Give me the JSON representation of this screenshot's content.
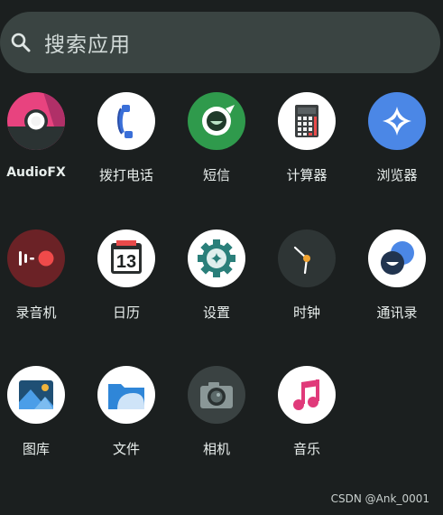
{
  "search": {
    "placeholder": "搜索应用"
  },
  "apps": [
    {
      "label": "AudioFX",
      "icon": "audiofx-icon"
    },
    {
      "label": "拨打电话",
      "icon": "phone-icon"
    },
    {
      "label": "短信",
      "icon": "messaging-icon"
    },
    {
      "label": "计算器",
      "icon": "calculator-icon"
    },
    {
      "label": "浏览器",
      "icon": "browser-icon"
    },
    {
      "label": "录音机",
      "icon": "recorder-icon"
    },
    {
      "label": "日历",
      "icon": "calendar-icon",
      "day": "13"
    },
    {
      "label": "设置",
      "icon": "settings-icon"
    },
    {
      "label": "时钟",
      "icon": "clock-icon"
    },
    {
      "label": "通讯录",
      "icon": "contacts-icon"
    },
    {
      "label": "图库",
      "icon": "gallery-icon"
    },
    {
      "label": "文件",
      "icon": "files-icon"
    },
    {
      "label": "相机",
      "icon": "camera-icon"
    },
    {
      "label": "音乐",
      "icon": "music-icon"
    }
  ],
  "watermark": "CSDN @Ank_0001",
  "colors": {
    "background": "#1b1f1f",
    "search_bar": "#3a4442",
    "audiofx": "#e8437f",
    "messaging": "#2f9a4c",
    "browser": "#4b87e6",
    "recorder_accent": "#f04a4a",
    "clock_hand": "#f0a330"
  }
}
